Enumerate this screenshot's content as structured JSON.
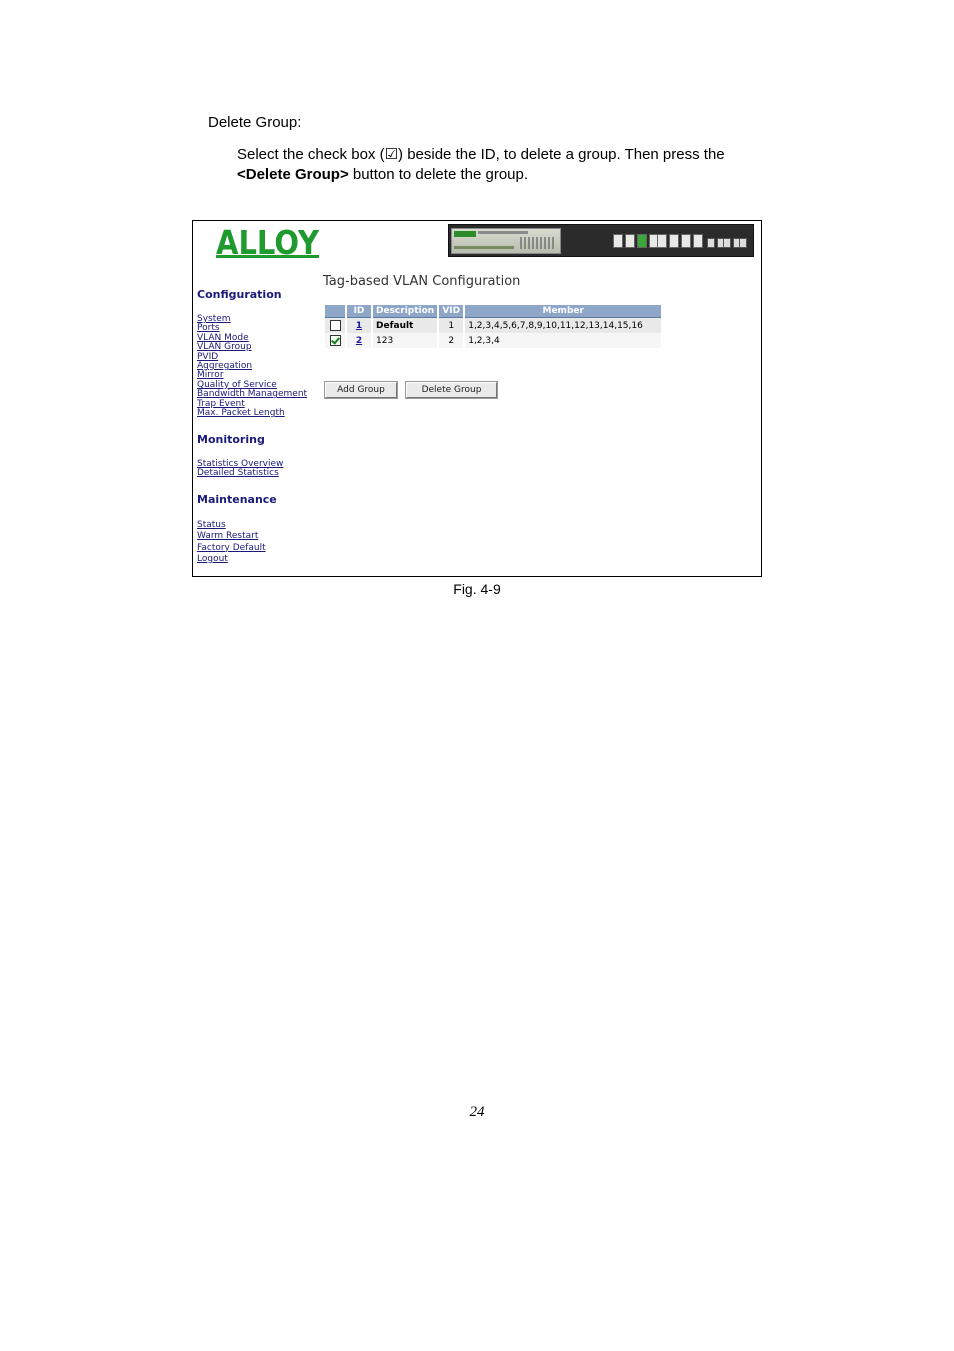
{
  "doc": {
    "heading": "Delete Group:",
    "para_before": "Select the check box (",
    "checkbox_glyph": "☑",
    "para_after": ") beside the ID, to delete a group. Then press the",
    "para_bold": "<Delete Group>",
    "para_tail": " button to delete the group.",
    "caption": "Fig. 4-9",
    "page_number": "24"
  },
  "app": {
    "logo_text": "ALLOY",
    "brand_color": "#1f9a2f",
    "page_title": "Tag-based VLAN Configuration",
    "sidebar": {
      "configuration": {
        "title": "Configuration",
        "items": [
          "System",
          "Ports",
          "VLAN Mode",
          "VLAN Group",
          "PVID",
          "Aggregation",
          "Mirror",
          "Quality of Service",
          "Bandwidth Management",
          "Trap Event",
          "Max. Packet Length"
        ]
      },
      "monitoring": {
        "title": "Monitoring",
        "items": [
          "Statistics Overview",
          "Detailed Statistics"
        ]
      },
      "maintenance": {
        "title": "Maintenance",
        "items": [
          "Status",
          "Warm Restart",
          "Factory Default",
          "Logout"
        ]
      }
    },
    "table": {
      "headers": [
        "",
        "ID",
        "Description",
        "VID",
        "Member"
      ],
      "rows": [
        {
          "checked": false,
          "id": "1",
          "description": "Default",
          "vid": "1",
          "member": "1,2,3,4,5,6,7,8,9,10,11,12,13,14,15,16"
        },
        {
          "checked": true,
          "id": "2",
          "description": "123",
          "vid": "2",
          "member": "1,2,3,4"
        }
      ]
    },
    "buttons": {
      "add_group": "Add Group",
      "delete_group": "Delete Group"
    },
    "header_color": "#8ea6c8"
  }
}
